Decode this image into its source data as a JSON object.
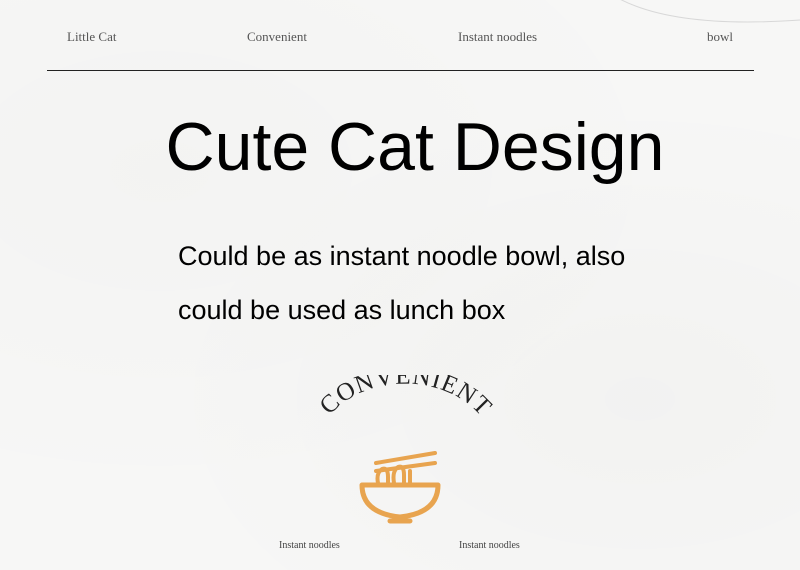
{
  "nav": {
    "items": [
      "Little Cat",
      "Convenient",
      "Instant noodles",
      "bowl"
    ]
  },
  "headline": "Cute Cat Design",
  "description": {
    "line1": "Could be as instant noodle bowl, also",
    "line2": "could be used as lunch box"
  },
  "emblem": {
    "arc_text": "CONVENIENT",
    "icon": "noodle-bowl-icon",
    "icon_color": "#e8a44f"
  },
  "footer": {
    "labels": [
      "Instant noodles",
      "Instant noodles"
    ]
  }
}
